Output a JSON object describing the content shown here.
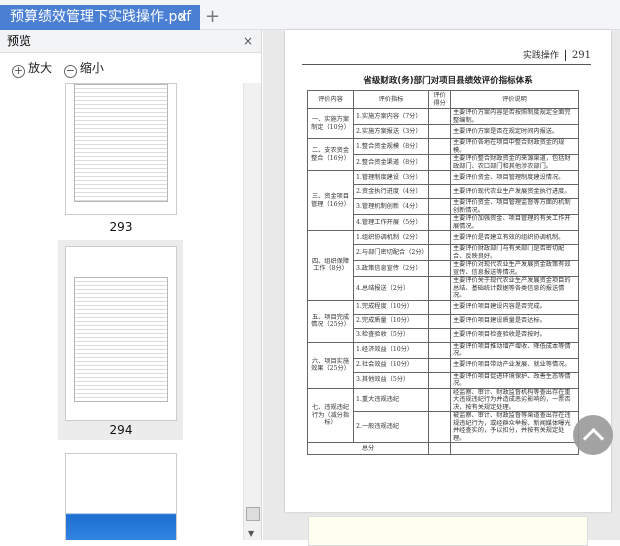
{
  "tab": {
    "title": "预算绩效管理下实践操作.pdf",
    "close": "×",
    "new_tab": "+"
  },
  "preview": {
    "title": "预览",
    "close": "×",
    "zoom_in": "放大",
    "zoom_out": "缩小",
    "pages": [
      "293",
      "294"
    ]
  },
  "page": {
    "header": "实践操作",
    "number": "291",
    "title": "省级财政(务)部门对项目县绩效评价指标体系",
    "columns": [
      "评价内容",
      "评价指标",
      "评价得分",
      "评价说明"
    ],
    "groups": [
      {
        "cat": "一、实施方案制定（10分）",
        "rows": [
          [
            "1.实施方案内容（7分）",
            "主要评价方案内容是否按照制度规定全面完整编制。"
          ],
          [
            "2.实施方案报送（3分）",
            "主要评价方案是否在规定时间内报送。"
          ]
        ]
      },
      {
        "cat": "二、支农资金整合（16分）",
        "rows": [
          [
            "1.整合资金规模（8分）",
            "主要评价各地在项目中整合财政资金的规模。"
          ],
          [
            "2.整合资金渠道（8分）",
            "主要评价整合财政资金的来源渠道，包括财政部门、农口部门和其他涉农部门。"
          ]
        ]
      },
      {
        "cat": "三、资金项目管理（16分）",
        "rows": [
          [
            "1.管理制度建设（3分）",
            "主要评价资金、项目管理制度建设情况。"
          ],
          [
            "2.资金执行进度（4分）",
            "主要评价现代农业生产发展资金执行进度。"
          ],
          [
            "3.管理机制创新（4分）",
            "主要评价资金、项目管理监督等方面的机制创新情况。"
          ],
          [
            "4.管理工作开展（5分）",
            "主要评价加强资金、项目管理的有关工作开展情况。"
          ]
        ]
      },
      {
        "cat": "四、组织保障工作（8分）",
        "rows": [
          [
            "1.组织协调机制（2分）",
            "主要评价是否建立有效的组织协调机制。"
          ],
          [
            "2.与部门密切配合（2分）",
            "主要评价财政部门与有关部门是否密切配合、反映良好。"
          ],
          [
            "3.政策信息宣传（2分）",
            "主要评价对现代农业生产发展资金政策有效宣传、信息报送等情况。"
          ],
          [
            "4.总结报送（2分）",
            "主要评价关于现代农业生产发展资金项目的总结、基础统计数据等各类信息的报送情况。"
          ]
        ]
      },
      {
        "cat": "五、项目完成情况（25分）",
        "rows": [
          [
            "1.完成程度（10分）",
            "主要评价项目建设内容是否完成。"
          ],
          [
            "2.完成质量（10分）",
            "主要评价项目建设质量是否达标。"
          ],
          [
            "3.检查验收（5分）",
            "主要评价项目检查验收是否按时。"
          ]
        ]
      },
      {
        "cat": "六、项目实施效果（25分）",
        "rows": [
          [
            "1.经济效益（10分）",
            "主要评价项目推动增产增收、降低成本等情况。"
          ],
          [
            "2.社会效益（10分）",
            "主要评价项目带动产业发展、就业等情况。"
          ],
          [
            "3.其他效益（5分）",
            "主要评价项目促进环境保护、改善生态等情况。"
          ]
        ]
      },
      {
        "cat": "七、违规违纪行为（减分指标）",
        "rows": [
          [
            "1.重大违规违纪",
            "经监察、审计、财政监督机构等查出存在重大违规违纪行为并造成恶劣影响的，一票否决，按有关规定处理。"
          ],
          [
            "2.一般违规违纪",
            "被监察、审计、财政监督等渠道查出存在违规违纪行为，或经群众举报、新闻媒体曝光并经查实的，予以扣分，并按有关规定处理。"
          ]
        ]
      }
    ],
    "total": "总分"
  }
}
